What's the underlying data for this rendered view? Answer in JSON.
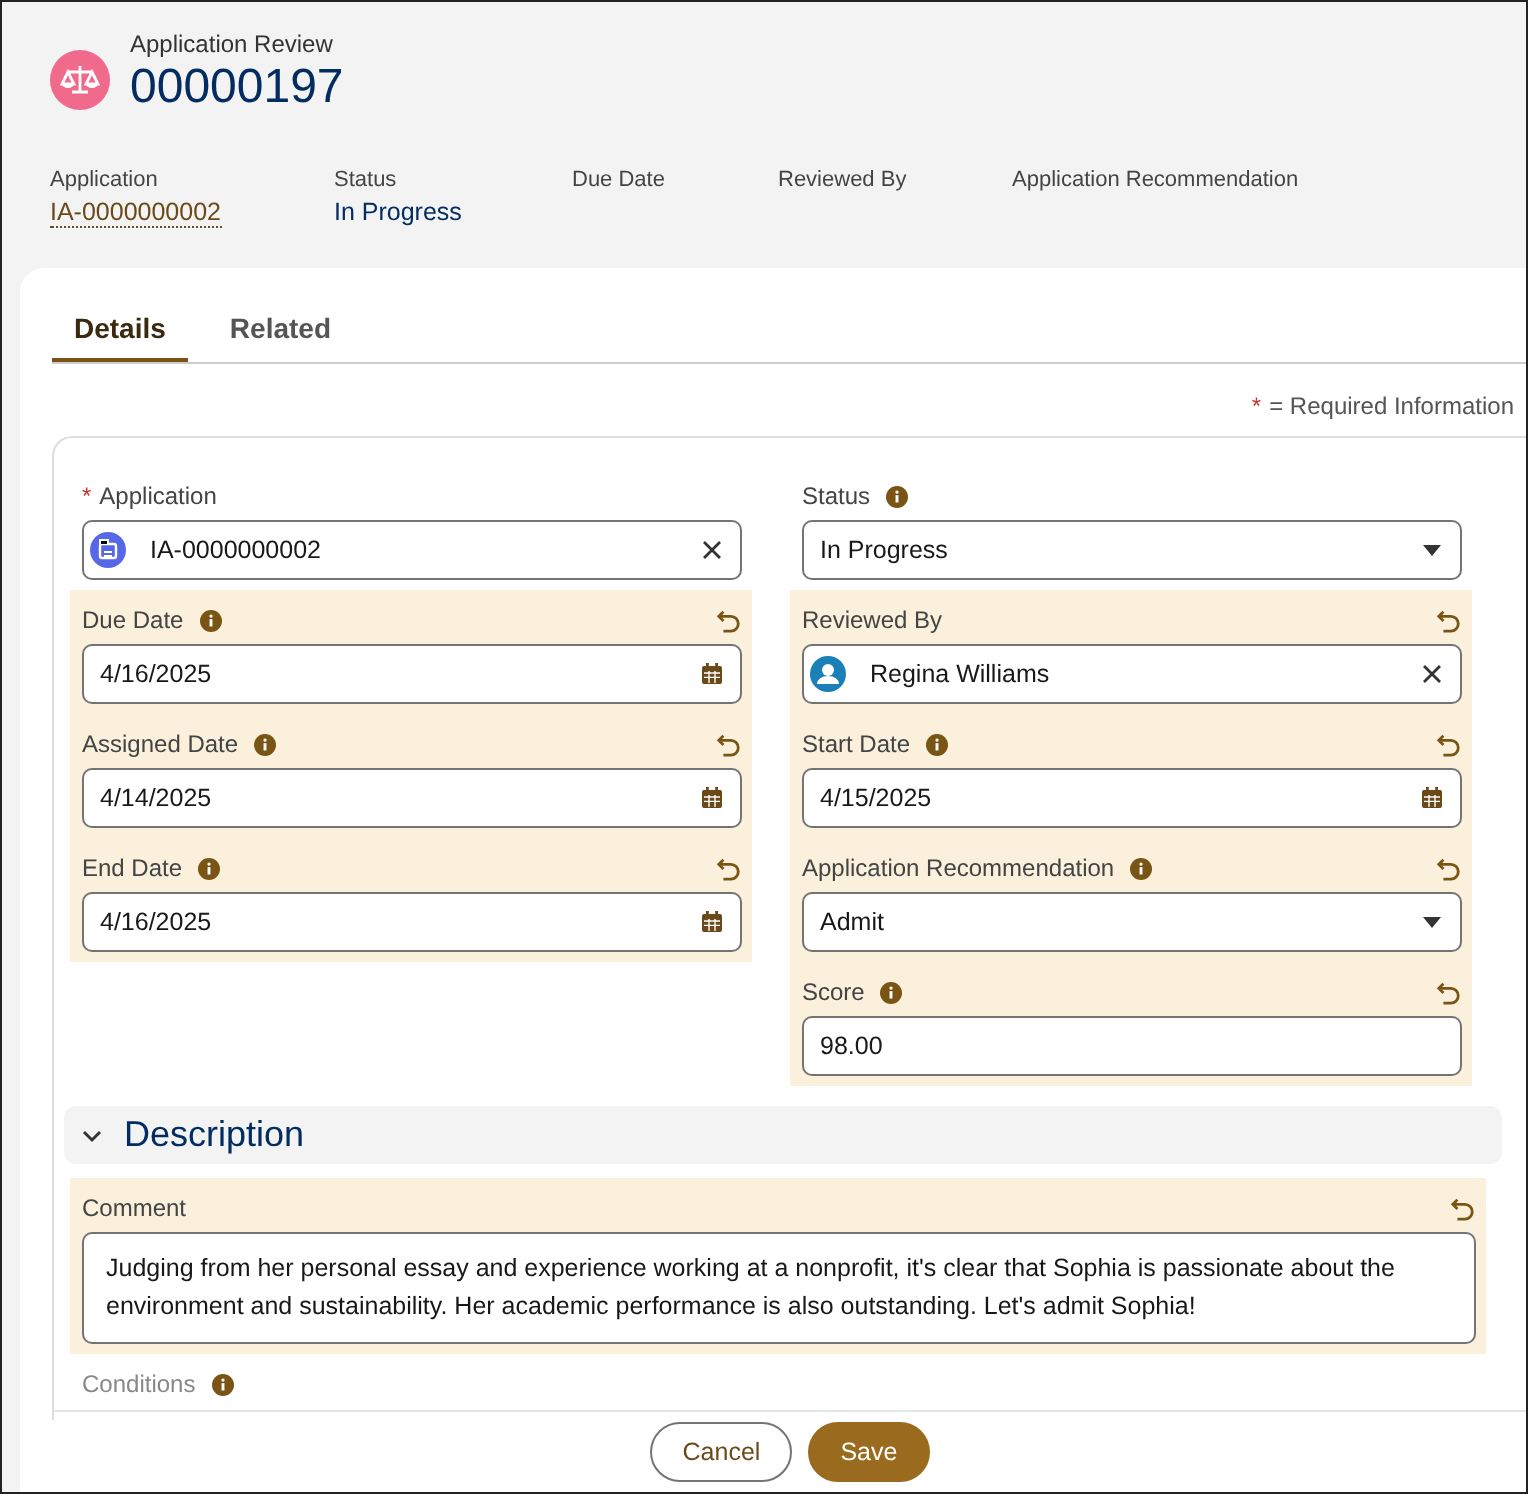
{
  "header": {
    "object_type": "Application Review",
    "title": "00000197",
    "highlights": [
      {
        "label": "Application",
        "value": "IA-0000000002",
        "kind": "link"
      },
      {
        "label": "Status",
        "value": "In Progress",
        "kind": "text"
      },
      {
        "label": "Due Date"
      },
      {
        "label": "Reviewed By"
      },
      {
        "label": "Application Recommendation"
      }
    ]
  },
  "tabs": [
    {
      "label": "Details",
      "selected": true
    },
    {
      "label": "Related",
      "selected": false
    }
  ],
  "required_note": {
    "marker": "*",
    "text": "= Required Information"
  },
  "columns": [
    [
      {
        "label": "Application",
        "kind": "record-lookup",
        "value": "IA-0000000002",
        "required": true,
        "info": false,
        "changed": false
      },
      {
        "label": "Due Date",
        "kind": "date",
        "value": "4/16/2025",
        "required": false,
        "info": true,
        "changed": true
      },
      {
        "label": "Assigned Date",
        "kind": "date",
        "value": "4/14/2025",
        "required": false,
        "info": true,
        "changed": true
      },
      {
        "label": "End Date",
        "kind": "date",
        "value": "4/16/2025",
        "required": false,
        "info": true,
        "changed": true
      }
    ],
    [
      {
        "label": "Status",
        "kind": "picklist",
        "value": "In Progress",
        "required": false,
        "info": true,
        "changed": false
      },
      {
        "label": "Reviewed By",
        "kind": "user-lookup",
        "value": "Regina Williams",
        "required": false,
        "info": false,
        "changed": true
      },
      {
        "label": "Start Date",
        "kind": "date",
        "value": "4/15/2025",
        "required": false,
        "info": true,
        "changed": true
      },
      {
        "label": "Application Recommendation",
        "kind": "picklist",
        "value": "Admit",
        "required": false,
        "info": true,
        "changed": true
      },
      {
        "label": "Score",
        "kind": "text",
        "value": "98.00",
        "required": false,
        "info": true,
        "changed": true
      }
    ]
  ],
  "section": {
    "title": "Description",
    "expanded": true,
    "fields": [
      {
        "label": "Comment",
        "kind": "textarea",
        "value": "Judging from her personal essay and experience working at a nonprofit, it's clear that Sophia is passionate about the environment and sustainability. Her academic performance is also outstanding. Let's admit Sophia!",
        "required": false,
        "info": false,
        "changed": true
      },
      {
        "label": "Conditions",
        "required": false,
        "info": true,
        "changed": false
      }
    ]
  },
  "footer": {
    "buttons": [
      {
        "label": "Cancel",
        "kind": "neutral"
      },
      {
        "label": "Save",
        "kind": "brand"
      }
    ]
  }
}
